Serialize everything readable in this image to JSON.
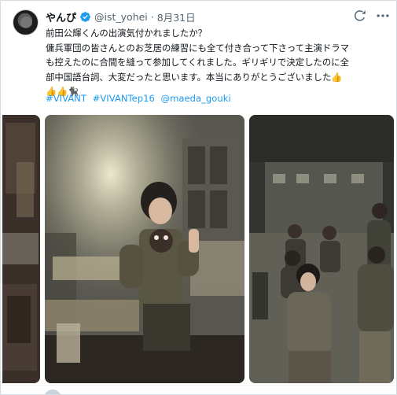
{
  "tweet": {
    "display_name": "やんぴ",
    "handle": "@ist_yohei",
    "separator": "·",
    "date": "8月31日",
    "lines": [
      "前田公輝くんの出演気付かれましたか？",
      "傭兵軍団の皆さんとのお芝居の練習にも全て付き合って下さって主演ドラマ",
      "も控えたのに合間を縫って参加してくれました。ギリギリで決定したのに全",
      "部中国語台詞、大変だったと思います。本当にありがとうございました👍",
      "👍👍🐈‍⬛"
    ],
    "hashtags": [
      "#VIVANT",
      "#VIVANTep16",
      "@maeda_gouki"
    ]
  },
  "icons": {
    "verified": "verified-badge-icon",
    "grok": "grok-icon",
    "more": "more-options-icon"
  },
  "colors": {
    "link": "#1d9bf0",
    "verified": "#1d9bf0",
    "secondary_text": "#536471"
  }
}
